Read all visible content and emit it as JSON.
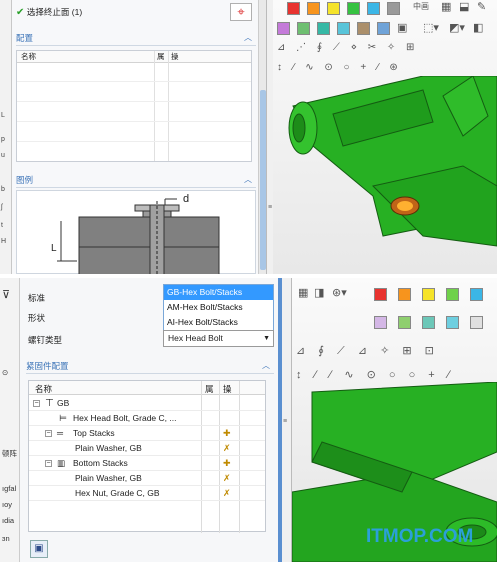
{
  "top_panel": {
    "stop_selection_label": "选择终止面 (1)",
    "config_section": "配置",
    "table_headers": [
      "名称",
      "属",
      "操"
    ],
    "preview_section": "图例",
    "dim_label": "d",
    "dim_label_side": "L",
    "left_strip_letters": [
      "L",
      "p",
      "u",
      "b",
      "ʃ",
      "t",
      "H"
    ]
  },
  "bottom_panel": {
    "standard_label": "标准",
    "shape_label": "形状",
    "bolt_type_label": "螺钉类型",
    "standard_options": [
      "GB-Hex Bolt/Stacks",
      "AM-Hex Bolt/Stacks",
      "AI-Hex Bolt/Stacks"
    ],
    "selected_standard_index": 0,
    "bolt_type_value": "Hex Head Bolt",
    "fastener_section": "紧固件配置",
    "tree_headers": [
      "名称",
      "属",
      "操"
    ],
    "tree_rows": [
      {
        "label": "GB",
        "indent": 0
      },
      {
        "label": "Hex Head Bolt, Grade C, ...",
        "indent": 1
      },
      {
        "label": "Top Stacks",
        "indent": 1
      },
      {
        "label": "Plain Washer, GB",
        "indent": 2
      },
      {
        "label": "Bottom Stacks",
        "indent": 1
      },
      {
        "label": "Plain Washer, GB",
        "indent": 2
      },
      {
        "label": "Hex Nut, Grade C, GB",
        "indent": 2
      }
    ],
    "left_strip_texts": [
      "顿阵",
      "ıgfal",
      "ıoy",
      "ıdia",
      "ɜn"
    ]
  },
  "watermark": "ITMOP.COM",
  "colors": {
    "accent_blue": "#3c74b8",
    "selection_blue": "#3399ff",
    "model_green": "#27b023",
    "arrow_red": "#e8332f",
    "swatches_top": [
      "#e8332f",
      "#f7941d",
      "#f5e32a",
      "#36c241",
      "#3bb6e6",
      "#9a9a9a",
      "#c47ad9",
      "#6ebf71",
      "#36b8a5",
      "#58c4d9",
      "#ab8f6b",
      "#6fa3d8"
    ],
    "swatches_bottom": [
      "#e8332f",
      "#f7941d",
      "#f5e32a",
      "#6fd14a",
      "#3bb6e6",
      "#d4b7e6",
      "#8fcf6f",
      "#6cc7b8",
      "#6ecfe0",
      "#e0e0e0"
    ]
  }
}
